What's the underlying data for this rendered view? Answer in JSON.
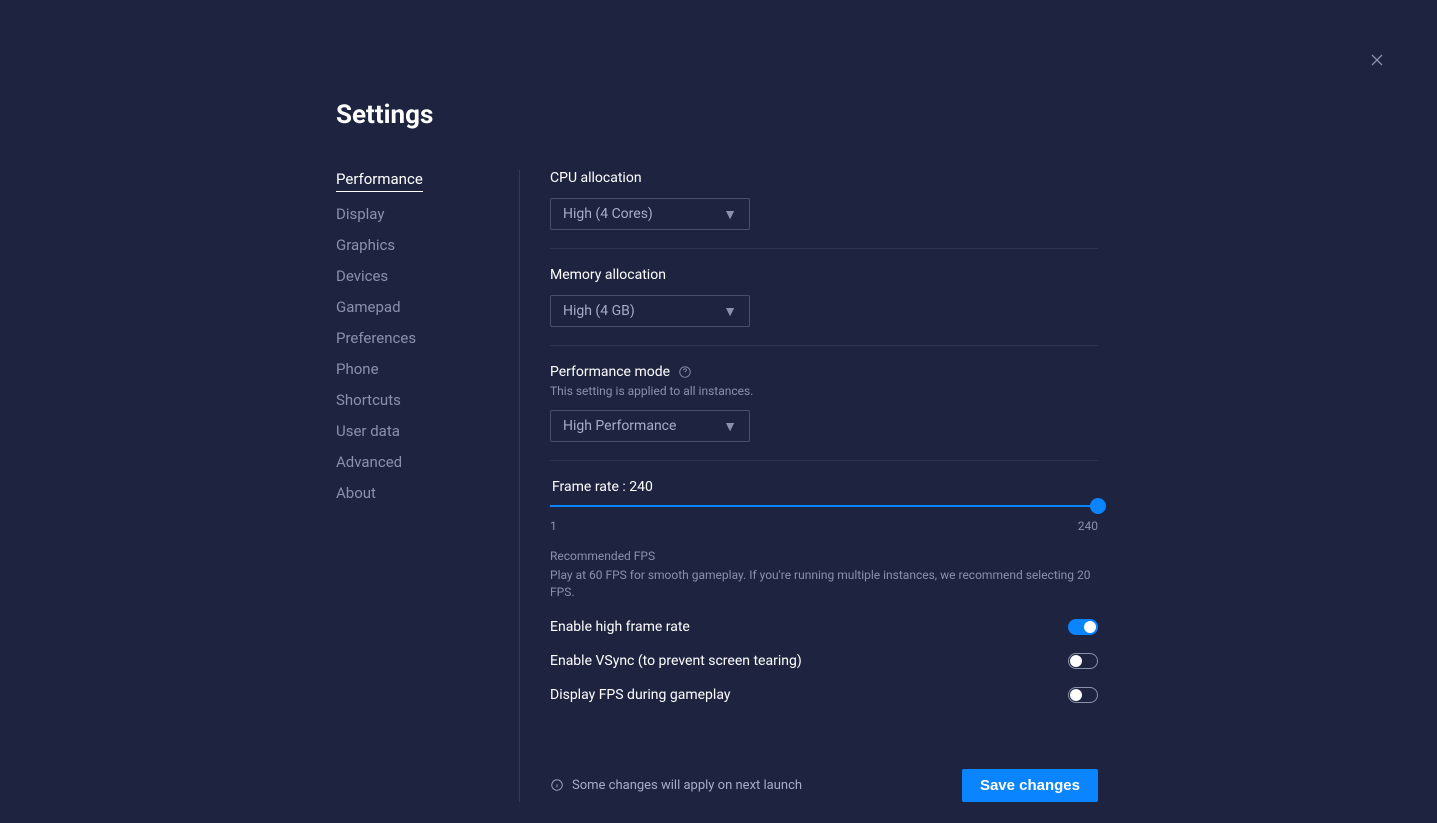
{
  "title": "Settings",
  "sidebar": {
    "items": [
      {
        "label": "Performance",
        "active": true
      },
      {
        "label": "Display"
      },
      {
        "label": "Graphics"
      },
      {
        "label": "Devices"
      },
      {
        "label": "Gamepad"
      },
      {
        "label": "Preferences"
      },
      {
        "label": "Phone"
      },
      {
        "label": "Shortcuts"
      },
      {
        "label": "User data"
      },
      {
        "label": "Advanced"
      },
      {
        "label": "About"
      }
    ]
  },
  "cpu": {
    "label": "CPU allocation",
    "value": "High (4 Cores)"
  },
  "memory": {
    "label": "Memory allocation",
    "value": "High (4 GB)"
  },
  "perfmode": {
    "label": "Performance mode",
    "hint": "This setting is applied to all instances.",
    "value": "High Performance"
  },
  "framerate": {
    "label_prefix": "Frame rate : ",
    "value": 240,
    "min": 1,
    "max": 240,
    "recommend_title": "Recommended FPS",
    "recommend_text": "Play at 60 FPS for smooth gameplay. If you're running multiple instances, we recommend selecting 20 FPS."
  },
  "toggles": {
    "highfr": {
      "label": "Enable high frame rate",
      "on": true
    },
    "vsync": {
      "label": "Enable VSync (to prevent screen tearing)",
      "on": false
    },
    "displayfps": {
      "label": "Display FPS during gameplay",
      "on": false
    }
  },
  "footer": {
    "note": "Some changes will apply on next launch",
    "save": "Save changes"
  }
}
